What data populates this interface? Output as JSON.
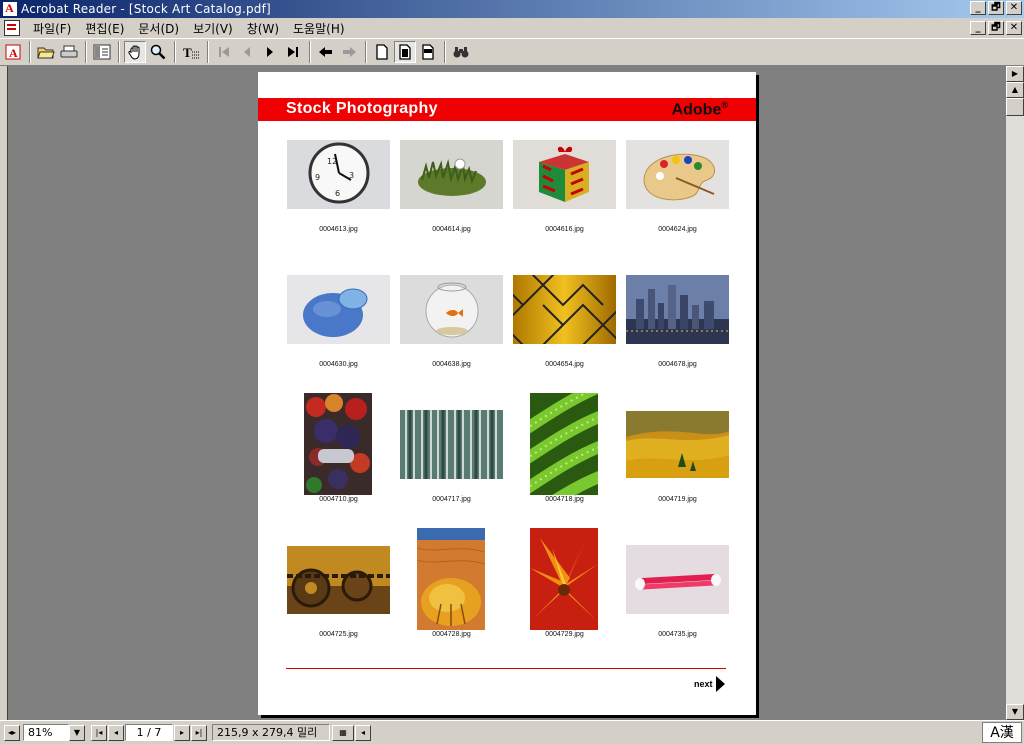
{
  "window": {
    "title": "Acrobat Reader - [Stock Art Catalog.pdf]",
    "buttons": [
      "_",
      "🗗",
      "✕"
    ]
  },
  "menu": {
    "items": [
      "파일(F)",
      "편집(E)",
      "문서(D)",
      "보기(V)",
      "창(W)",
      "도움말(H)"
    ]
  },
  "toolbar": {
    "icons": [
      "acrobat-logo-icon",
      "open-icon",
      "print-icon",
      "show-hide-navigation-icon",
      "hand-tool-icon",
      "zoom-tool-icon",
      "text-select-tool-icon",
      "first-page-icon",
      "previous-page-icon",
      "next-page-icon",
      "last-page-icon",
      "go-back-icon",
      "go-forward-icon",
      "actual-size-icon",
      "fit-page-icon",
      "fit-width-icon",
      "find-icon"
    ]
  },
  "page": {
    "banner_left": "Stock Photography",
    "banner_right": "Adobe",
    "banner_right_mark": "®",
    "next_label": "next",
    "thumbnails": [
      {
        "file": "0004613.jpg",
        "subject": "clock"
      },
      {
        "file": "0004614.jpg",
        "subject": "golf-ball-grass"
      },
      {
        "file": "0004616.jpg",
        "subject": "gift-box"
      },
      {
        "file": "0004624.jpg",
        "subject": "paint-palette"
      },
      {
        "file": "0004630.jpg",
        "subject": "ice-bag"
      },
      {
        "file": "0004638.jpg",
        "subject": "goldfish-bowl"
      },
      {
        "file": "0004654.jpg",
        "subject": "chain-link-fence"
      },
      {
        "file": "0004678.jpg",
        "subject": "city-skyline"
      },
      {
        "file": "0004710.jpg",
        "subject": "grapes-harvest"
      },
      {
        "file": "0004717.jpg",
        "subject": "aspen-forest"
      },
      {
        "file": "0004718.jpg",
        "subject": "aloe-leaves"
      },
      {
        "file": "0004719.jpg",
        "subject": "autumn-hillside"
      },
      {
        "file": "0004725.jpg",
        "subject": "rusty-gear-chain"
      },
      {
        "file": "0004728.jpg",
        "subject": "desert-shrub"
      },
      {
        "file": "0004729.jpg",
        "subject": "orange-flower"
      },
      {
        "file": "0004735.jpg",
        "subject": "swabs"
      }
    ]
  },
  "status": {
    "zoom": "81%",
    "page_indicator": "1 / 7",
    "page_size": "215,9 x 279,4 밀리",
    "ime_label": "A漢"
  }
}
